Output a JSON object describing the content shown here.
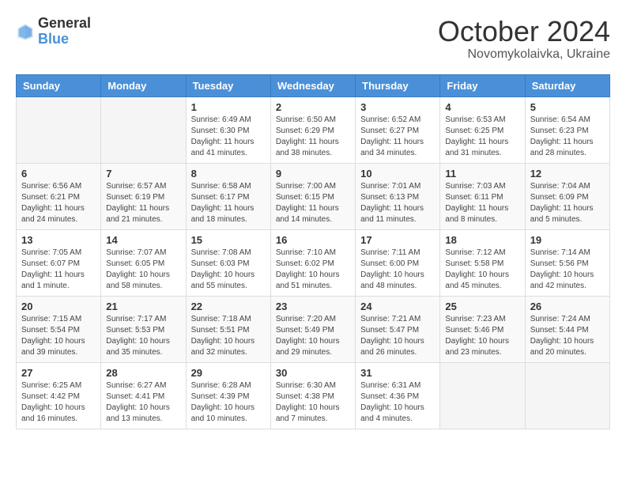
{
  "header": {
    "logo_general": "General",
    "logo_blue": "Blue",
    "month_title": "October 2024",
    "subtitle": "Novomykolaivka, Ukraine"
  },
  "days_of_week": [
    "Sunday",
    "Monday",
    "Tuesday",
    "Wednesday",
    "Thursday",
    "Friday",
    "Saturday"
  ],
  "weeks": [
    [
      {
        "day": "",
        "info": ""
      },
      {
        "day": "",
        "info": ""
      },
      {
        "day": "1",
        "info": "Sunrise: 6:49 AM\nSunset: 6:30 PM\nDaylight: 11 hours and 41 minutes."
      },
      {
        "day": "2",
        "info": "Sunrise: 6:50 AM\nSunset: 6:29 PM\nDaylight: 11 hours and 38 minutes."
      },
      {
        "day": "3",
        "info": "Sunrise: 6:52 AM\nSunset: 6:27 PM\nDaylight: 11 hours and 34 minutes."
      },
      {
        "day": "4",
        "info": "Sunrise: 6:53 AM\nSunset: 6:25 PM\nDaylight: 11 hours and 31 minutes."
      },
      {
        "day": "5",
        "info": "Sunrise: 6:54 AM\nSunset: 6:23 PM\nDaylight: 11 hours and 28 minutes."
      }
    ],
    [
      {
        "day": "6",
        "info": "Sunrise: 6:56 AM\nSunset: 6:21 PM\nDaylight: 11 hours and 24 minutes."
      },
      {
        "day": "7",
        "info": "Sunrise: 6:57 AM\nSunset: 6:19 PM\nDaylight: 11 hours and 21 minutes."
      },
      {
        "day": "8",
        "info": "Sunrise: 6:58 AM\nSunset: 6:17 PM\nDaylight: 11 hours and 18 minutes."
      },
      {
        "day": "9",
        "info": "Sunrise: 7:00 AM\nSunset: 6:15 PM\nDaylight: 11 hours and 14 minutes."
      },
      {
        "day": "10",
        "info": "Sunrise: 7:01 AM\nSunset: 6:13 PM\nDaylight: 11 hours and 11 minutes."
      },
      {
        "day": "11",
        "info": "Sunrise: 7:03 AM\nSunset: 6:11 PM\nDaylight: 11 hours and 8 minutes."
      },
      {
        "day": "12",
        "info": "Sunrise: 7:04 AM\nSunset: 6:09 PM\nDaylight: 11 hours and 5 minutes."
      }
    ],
    [
      {
        "day": "13",
        "info": "Sunrise: 7:05 AM\nSunset: 6:07 PM\nDaylight: 11 hours and 1 minute."
      },
      {
        "day": "14",
        "info": "Sunrise: 7:07 AM\nSunset: 6:05 PM\nDaylight: 10 hours and 58 minutes."
      },
      {
        "day": "15",
        "info": "Sunrise: 7:08 AM\nSunset: 6:03 PM\nDaylight: 10 hours and 55 minutes."
      },
      {
        "day": "16",
        "info": "Sunrise: 7:10 AM\nSunset: 6:02 PM\nDaylight: 10 hours and 51 minutes."
      },
      {
        "day": "17",
        "info": "Sunrise: 7:11 AM\nSunset: 6:00 PM\nDaylight: 10 hours and 48 minutes."
      },
      {
        "day": "18",
        "info": "Sunrise: 7:12 AM\nSunset: 5:58 PM\nDaylight: 10 hours and 45 minutes."
      },
      {
        "day": "19",
        "info": "Sunrise: 7:14 AM\nSunset: 5:56 PM\nDaylight: 10 hours and 42 minutes."
      }
    ],
    [
      {
        "day": "20",
        "info": "Sunrise: 7:15 AM\nSunset: 5:54 PM\nDaylight: 10 hours and 39 minutes."
      },
      {
        "day": "21",
        "info": "Sunrise: 7:17 AM\nSunset: 5:53 PM\nDaylight: 10 hours and 35 minutes."
      },
      {
        "day": "22",
        "info": "Sunrise: 7:18 AM\nSunset: 5:51 PM\nDaylight: 10 hours and 32 minutes."
      },
      {
        "day": "23",
        "info": "Sunrise: 7:20 AM\nSunset: 5:49 PM\nDaylight: 10 hours and 29 minutes."
      },
      {
        "day": "24",
        "info": "Sunrise: 7:21 AM\nSunset: 5:47 PM\nDaylight: 10 hours and 26 minutes."
      },
      {
        "day": "25",
        "info": "Sunrise: 7:23 AM\nSunset: 5:46 PM\nDaylight: 10 hours and 23 minutes."
      },
      {
        "day": "26",
        "info": "Sunrise: 7:24 AM\nSunset: 5:44 PM\nDaylight: 10 hours and 20 minutes."
      }
    ],
    [
      {
        "day": "27",
        "info": "Sunrise: 6:25 AM\nSunset: 4:42 PM\nDaylight: 10 hours and 16 minutes."
      },
      {
        "day": "28",
        "info": "Sunrise: 6:27 AM\nSunset: 4:41 PM\nDaylight: 10 hours and 13 minutes."
      },
      {
        "day": "29",
        "info": "Sunrise: 6:28 AM\nSunset: 4:39 PM\nDaylight: 10 hours and 10 minutes."
      },
      {
        "day": "30",
        "info": "Sunrise: 6:30 AM\nSunset: 4:38 PM\nDaylight: 10 hours and 7 minutes."
      },
      {
        "day": "31",
        "info": "Sunrise: 6:31 AM\nSunset: 4:36 PM\nDaylight: 10 hours and 4 minutes."
      },
      {
        "day": "",
        "info": ""
      },
      {
        "day": "",
        "info": ""
      }
    ]
  ]
}
